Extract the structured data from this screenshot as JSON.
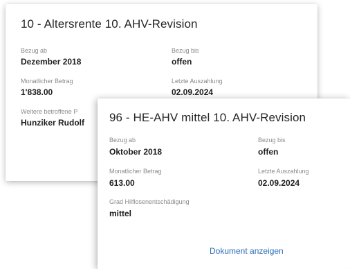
{
  "back_card": {
    "title": "10 - Altersrente 10. AHV-Revision",
    "fields": {
      "bezug_ab_label": "Bezug ab",
      "bezug_ab_value": "Dezember 2018",
      "bezug_bis_label": "Bezug bis",
      "bezug_bis_value": "offen",
      "betrag_label": "Monatlicher Betrag",
      "betrag_value": "1'838.00",
      "auszahlung_label": "Letzte Auszahlung",
      "auszahlung_value": "02.09.2024",
      "weitere_label": "Weitere betroffene P",
      "weitere_value": "Hunziker Rudolf"
    }
  },
  "front_card": {
    "title": "96 - HE-AHV mittel 10. AHV-Revision",
    "fields": {
      "bezug_ab_label": "Bezug ab",
      "bezug_ab_value": "Oktober 2018",
      "bezug_bis_label": "Bezug bis",
      "bezug_bis_value": "offen",
      "betrag_label": "Monatlicher Betrag",
      "betrag_value": "613.00",
      "auszahlung_label": "Letzte Auszahlung",
      "auszahlung_value": "02.09.2024",
      "grad_label": "Grad Hilflosenentschädigung",
      "grad_value": "mittel"
    },
    "document_link": "Dokument anzeigen"
  },
  "colors": {
    "link": "#2a6db8",
    "label": "#8a8a8a",
    "value": "#1e1e1e"
  }
}
